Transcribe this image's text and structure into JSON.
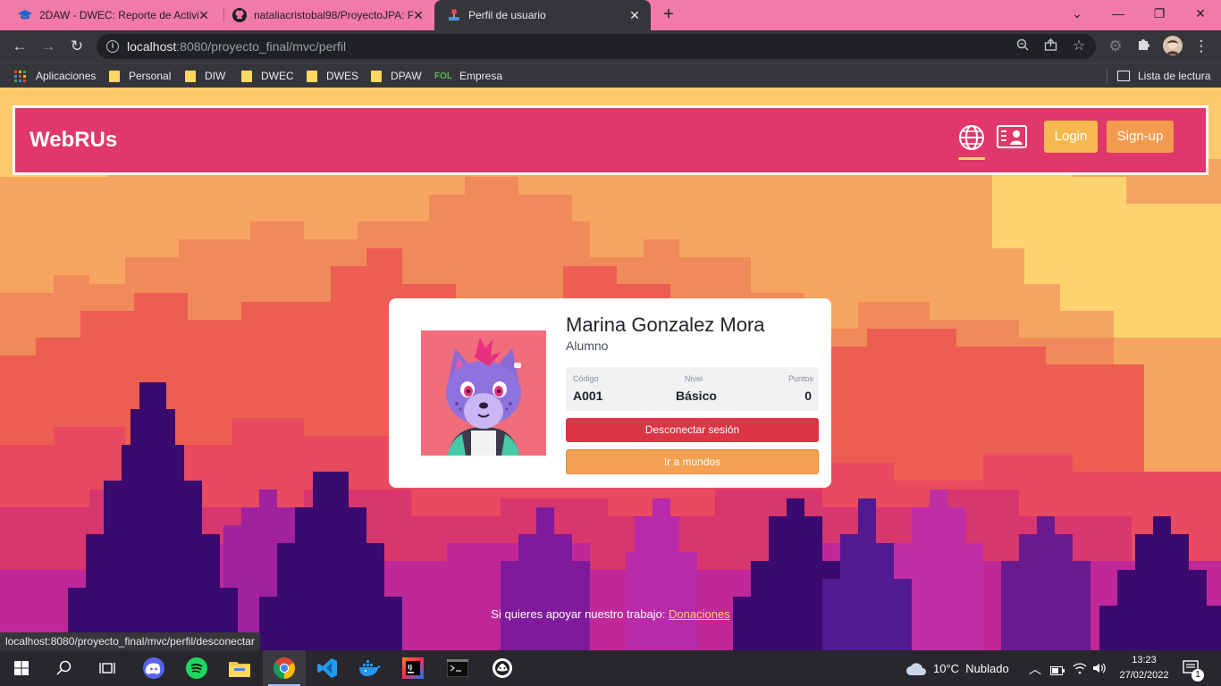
{
  "browser": {
    "tabs": [
      {
        "title": "2DAW - DWEC: Reporte de Activi",
        "icon": "graduation-cap-icon"
      },
      {
        "title": "nataliacristobal98/ProyectoJPA: P",
        "icon": "github-icon"
      },
      {
        "title": "Perfil de usuario",
        "icon": "joystick-icon"
      }
    ],
    "url_host": "localhost",
    "url_path": ":8080/proyecto_final/mvc/perfil",
    "bookmarks": [
      {
        "label": "Aplicaciones",
        "icon": "apps-grid-icon"
      },
      {
        "label": "Personal",
        "icon": "folder-icon"
      },
      {
        "label": "DIW",
        "icon": "folder-icon"
      },
      {
        "label": "DWEC",
        "icon": "folder-icon"
      },
      {
        "label": "DWES",
        "icon": "folder-icon"
      },
      {
        "label": "DPAW",
        "icon": "folder-icon"
      },
      {
        "label": "Empresa",
        "icon": "fol-icon"
      }
    ],
    "fol_icon_text": "FOL",
    "reading_list": "Lista de lectura",
    "status_url": "localhost:8080/proyecto_final/mvc/perfil/desconectar"
  },
  "site": {
    "brand": "WebRUs",
    "login": "Login",
    "signup": "Sign-up"
  },
  "profile": {
    "name": "Marina Gonzalez Mora",
    "role": "Alumno",
    "stats": [
      {
        "label": "Código",
        "value": "A001"
      },
      {
        "label": "Nivel",
        "value": "Básico"
      },
      {
        "label": "Puntos",
        "value": "0"
      }
    ],
    "disconnect": "Desconectar sesión",
    "worlds": "Ir a mundos"
  },
  "footer": {
    "text": "Si quieres apoyar nuestro trabajo: ",
    "link": "Donaciones"
  },
  "taskbar": {
    "weather_temp": "10°C",
    "weather_desc": "Nublado",
    "time": "13:23",
    "date": "27/02/2022",
    "notifications": "1"
  },
  "colors": {
    "tabbar": "#f27aa8",
    "navbar": "#e0386a",
    "login_btn": "#f7b94f",
    "signup_btn": "#f49a4e",
    "danger": "#dc3545",
    "link": "#fdd36a"
  }
}
